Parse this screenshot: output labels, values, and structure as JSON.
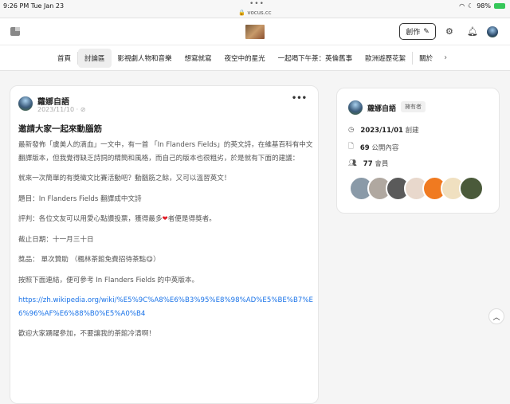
{
  "status": {
    "time": "9:26 PM   Tue Jan 23",
    "url": "vocus.cc",
    "battery": "98%"
  },
  "header": {
    "create_label": "創作"
  },
  "tabs": [
    "首頁",
    "討論區",
    "影視劇人物和音樂",
    "想寫就寫",
    "夜空中的星光",
    "一起喝下午茶：英倫舊事",
    "歐洲遊歷花絮",
    "關於"
  ],
  "post": {
    "author": "蘿娜自語",
    "date": "2023/11/10 · ",
    "title": "邀請大家一起來動腦筋",
    "paragraphs": [
      "最新發佈「虞美人的滴血」一文中，有一首 「In Flanders Fields」的英文詩，在維基百科有中文翻譯版本，但我覺得缺乏詩詞的精簡和風格，而自己的版本也很粗劣，於是就有下面的建議：",
      "就來一次簡單的有獎徵文比賽活動吧？動腦筋之餘，又可以溫習英文！",
      "題目：In Flanders Fields 翻譯成中文詩"
    ],
    "judge_a": "評判：各位文友可以用愛心點讚投票，獲得最多",
    "judge_b": "者便是得獎者。",
    "deadline": "截止日期：十一月三十日",
    "prize": "獎品： 單次贊助 （楓林茶館免費招待茶點😋）",
    "ref": "按照下面連結，便可參考 In Flanders Fields 的中英版本。",
    "link": "https://zh.wikipedia.org/wiki/%E5%9C%A8%E6%B3%95%E8%98%AD%E5%BE%B7%E6%96%AF%E6%88%B0%E5%A0%B4",
    "closing": "歡迎大家踴躍參加，不要讓我的茶館冷清啊！"
  },
  "side": {
    "name": "蘿娜自語",
    "badge": "擁有者",
    "created_date": "2023/11/01",
    "created_label": "創建",
    "posts_count": "69",
    "posts_label": "公開內容",
    "members_count": "77",
    "members_label": "會員"
  },
  "colors": {
    "link": "#1a73e8",
    "heart": "#e0202a"
  }
}
